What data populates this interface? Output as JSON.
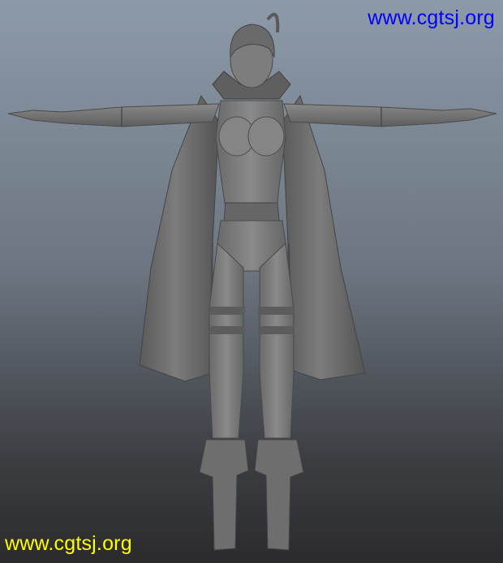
{
  "viewport": {
    "background_top": "#8d9aa9",
    "background_bottom": "#2b2b2d",
    "subject": "t-pose-character-model"
  },
  "watermarks": {
    "top_right": {
      "text": "www.cgtsj.org",
      "color": "#0000ff"
    },
    "bottom_left": {
      "text": "www.cgtsj.org",
      "color": "#ffff00"
    }
  },
  "colors": {
    "model_base": "#7e7e7e",
    "model_shadow": "#4e4e4e",
    "model_highlight": "#9c9c9c"
  }
}
